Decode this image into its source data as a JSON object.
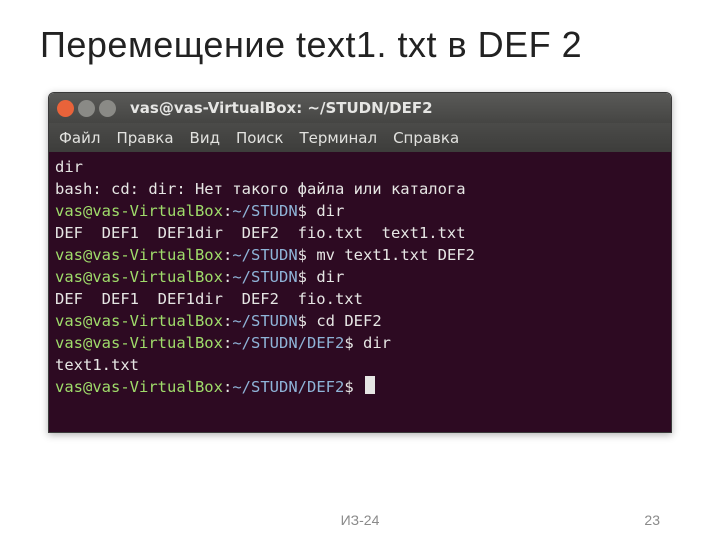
{
  "slide": {
    "title": "Перемещение text1. txt в DEF 2"
  },
  "titlebar": {
    "title": "vas@vas-VirtualBox: ~/STUDN/DEF2"
  },
  "menu": {
    "file": "Файл",
    "edit": "Правка",
    "view": "Вид",
    "search": "Поиск",
    "terminal": "Терминал",
    "help": "Справка"
  },
  "terminal": {
    "lines": [
      {
        "type": "plain",
        "text": "dir"
      },
      {
        "type": "plain",
        "text": "bash: cd: dir: Нет такого файла или каталога"
      },
      {
        "type": "prompt",
        "user": "vas@vas-VirtualBox",
        "path": "~/STUDN",
        "cmd": "dir"
      },
      {
        "type": "plain",
        "text": "DEF  DEF1  DEF1dir  DEF2  fio.txt  text1.txt"
      },
      {
        "type": "prompt",
        "user": "vas@vas-VirtualBox",
        "path": "~/STUDN",
        "cmd": "mv text1.txt DEF2"
      },
      {
        "type": "prompt",
        "user": "vas@vas-VirtualBox",
        "path": "~/STUDN",
        "cmd": "dir"
      },
      {
        "type": "plain",
        "text": "DEF  DEF1  DEF1dir  DEF2  fio.txt"
      },
      {
        "type": "prompt",
        "user": "vas@vas-VirtualBox",
        "path": "~/STUDN",
        "cmd": "cd DEF2"
      },
      {
        "type": "prompt",
        "user": "vas@vas-VirtualBox",
        "path": "~/STUDN/DEF2",
        "cmd": "dir"
      },
      {
        "type": "plain",
        "text": "text1.txt"
      },
      {
        "type": "prompt",
        "user": "vas@vas-VirtualBox",
        "path": "~/STUDN/DEF2",
        "cmd": "",
        "cursor": true
      }
    ]
  },
  "footer": {
    "center": "ИЗ-24",
    "right": "23"
  }
}
